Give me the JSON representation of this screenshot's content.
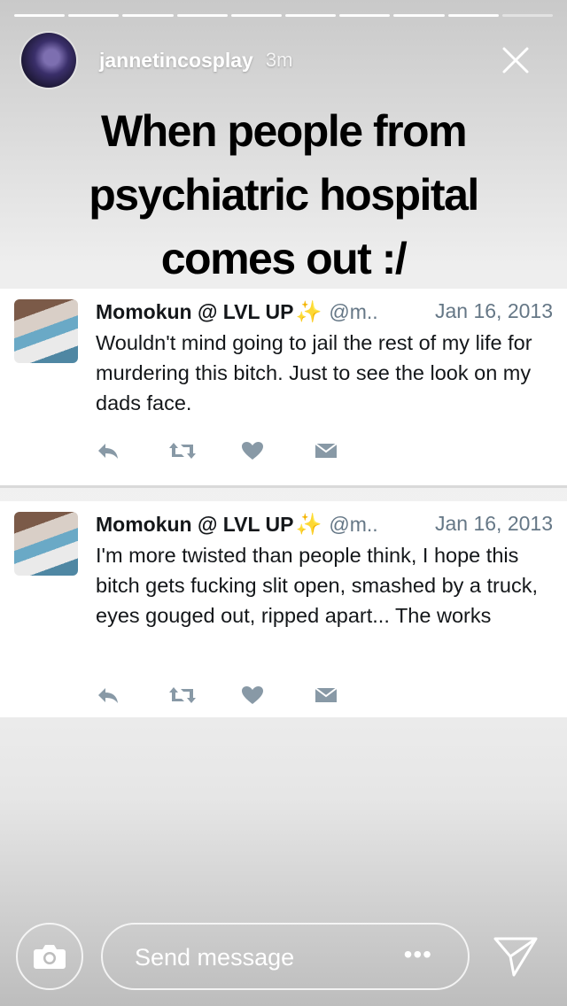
{
  "story": {
    "progress": {
      "segments": 10,
      "completed": 9
    },
    "user": {
      "username": "jannetincosplay",
      "time_ago": "3m"
    },
    "caption": {
      "lines": [
        "When people from",
        "psychiatric hospital",
        "comes out    :/"
      ]
    }
  },
  "tweets": [
    {
      "name": "Momokun @ LVL UP",
      "sparkle": "✨",
      "handle": "@m..",
      "date": "Jan 16, 2013",
      "text": "Wouldn't mind going to jail the rest of my life for murdering this bitch. Just to see the look on my dads face."
    },
    {
      "name": "Momokun @ LVL UP",
      "sparkle": "✨",
      "handle": "@m..",
      "date": "Jan 16, 2013",
      "text": "I'm more twisted than people think, I hope this bitch gets fucking slit open, smashed by a truck, eyes gouged out, ripped apart... The works"
    }
  ],
  "tweet_actions": [
    "reply-icon",
    "retweet-icon",
    "like-icon",
    "message-icon"
  ],
  "composer": {
    "placeholder": "Send message",
    "more": "•••"
  },
  "colors": {
    "twitter_gray": "#657786",
    "sparkle": "#b48be8"
  }
}
